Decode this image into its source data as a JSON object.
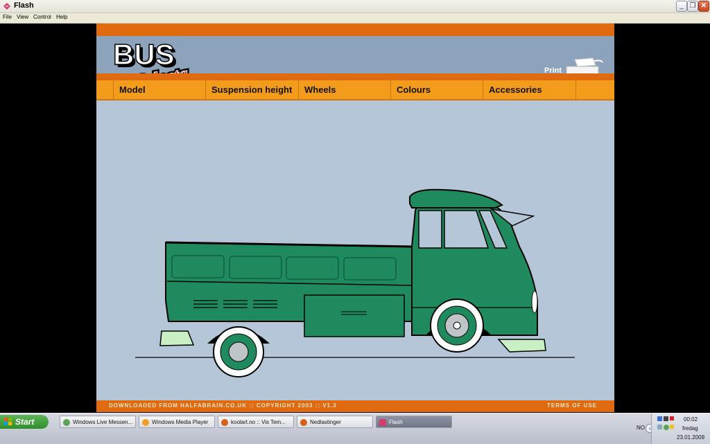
{
  "window": {
    "title": "Flash",
    "controls": {
      "minimize": "_",
      "maximize": "❐",
      "close": "✕"
    }
  },
  "menu": [
    "File",
    "View",
    "Control",
    "Help"
  ],
  "header": {
    "logo_top": "BUS",
    "logo_bottom": "Selecta",
    "print_label": "Print",
    "print_icon": "printer-icon"
  },
  "nav": [
    "Model",
    "Suspension height",
    "Wheels",
    "Colours",
    "Accessories"
  ],
  "vehicle": {
    "body_color": "#1f8a5e",
    "trim_color": "#c9efc4",
    "description_icon": "vw-pickup-illustration"
  },
  "footer": {
    "left": "DOWNLOADED FROM HALFABRAIN.CO.UK :: COPYRIGHT 2003 :: V1.3",
    "right": "TERMS OF USE"
  },
  "taskbar": {
    "start_label": "Start",
    "tasks": [
      {
        "label": "Windows Live Messen...",
        "icon": "messenger-icon"
      },
      {
        "label": "Windows Media Player",
        "icon": "media-player-icon"
      },
      {
        "label": "koolart.no :: Vis Tem...",
        "icon": "firefox-icon"
      },
      {
        "label": "Nedlastinger",
        "icon": "firefox-icon"
      },
      {
        "label": "Flash",
        "icon": "flash-icon"
      }
    ],
    "tray": {
      "language": "NO",
      "time": "00:02",
      "day": "fredag",
      "date": "23.01.2009"
    }
  },
  "colors": {
    "orange": "#e06a10",
    "nav_orange": "#f39c1c",
    "header_blue": "#8da3bc",
    "stage_blue": "#b5c6d8"
  }
}
